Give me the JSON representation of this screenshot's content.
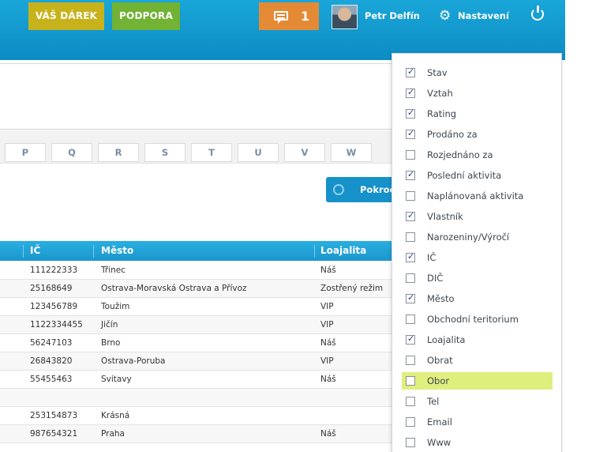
{
  "header": {
    "gift_label": "VÁŠ DÁREK",
    "support_label": "PODPORA",
    "message_count": "1",
    "user_name": "Petr Delfín",
    "settings_label": "Nastavení"
  },
  "alphabet": [
    "P",
    "Q",
    "R",
    "S",
    "T",
    "U",
    "V",
    "W"
  ],
  "advanced_button": "Pokročilé",
  "table": {
    "columns": [
      "IČ",
      "Město",
      "Loajalita"
    ],
    "rows": [
      {
        "ic": "111222333",
        "mesto": "Třinec",
        "loajalita": "Náš"
      },
      {
        "ic": "25168649",
        "mesto": "Ostrava-Moravská Ostrava a Přívoz",
        "loajalita": "Zostřený režim"
      },
      {
        "ic": "123456789",
        "mesto": "Toužim",
        "loajalita": "VIP"
      },
      {
        "ic": "1122334455",
        "mesto": "Jičín",
        "loajalita": "VIP"
      },
      {
        "ic": "56247103",
        "mesto": "Brno",
        "loajalita": "Náš"
      },
      {
        "ic": "26843820",
        "mesto": "Ostrava-Poruba",
        "loajalita": "VIP"
      },
      {
        "ic": "55455463",
        "mesto": "Svitavy",
        "loajalita": "Náš"
      },
      {
        "ic": "",
        "mesto": "",
        "loajalita": ""
      },
      {
        "ic": "253154873",
        "mesto": "Krásná",
        "loajalita": ""
      },
      {
        "ic": "987654321",
        "mesto": "Praha",
        "loajalita": "Náš"
      }
    ]
  },
  "columns_menu": [
    {
      "label": "Stav",
      "checked": true
    },
    {
      "label": "Vztah",
      "checked": true
    },
    {
      "label": "Rating",
      "checked": true
    },
    {
      "label": "Prodáno za",
      "checked": true
    },
    {
      "label": "Rozjednáno za",
      "checked": false
    },
    {
      "label": "Poslední aktivita",
      "checked": true
    },
    {
      "label": "Naplánovaná aktivita",
      "checked": false
    },
    {
      "label": "Vlastník",
      "checked": true
    },
    {
      "label": "Narozeniny/Výročí",
      "checked": false
    },
    {
      "label": "IČ",
      "checked": true
    },
    {
      "label": "DIČ",
      "checked": false
    },
    {
      "label": "Město",
      "checked": true
    },
    {
      "label": "Obchodní teritorium",
      "checked": false
    },
    {
      "label": "Loajalita",
      "checked": true
    },
    {
      "label": "Obrat",
      "checked": false
    },
    {
      "label": "Obor",
      "checked": false,
      "highlighted": true
    },
    {
      "label": "Tel",
      "checked": false
    },
    {
      "label": "Email",
      "checked": false
    },
    {
      "label": "Www",
      "checked": false
    }
  ]
}
